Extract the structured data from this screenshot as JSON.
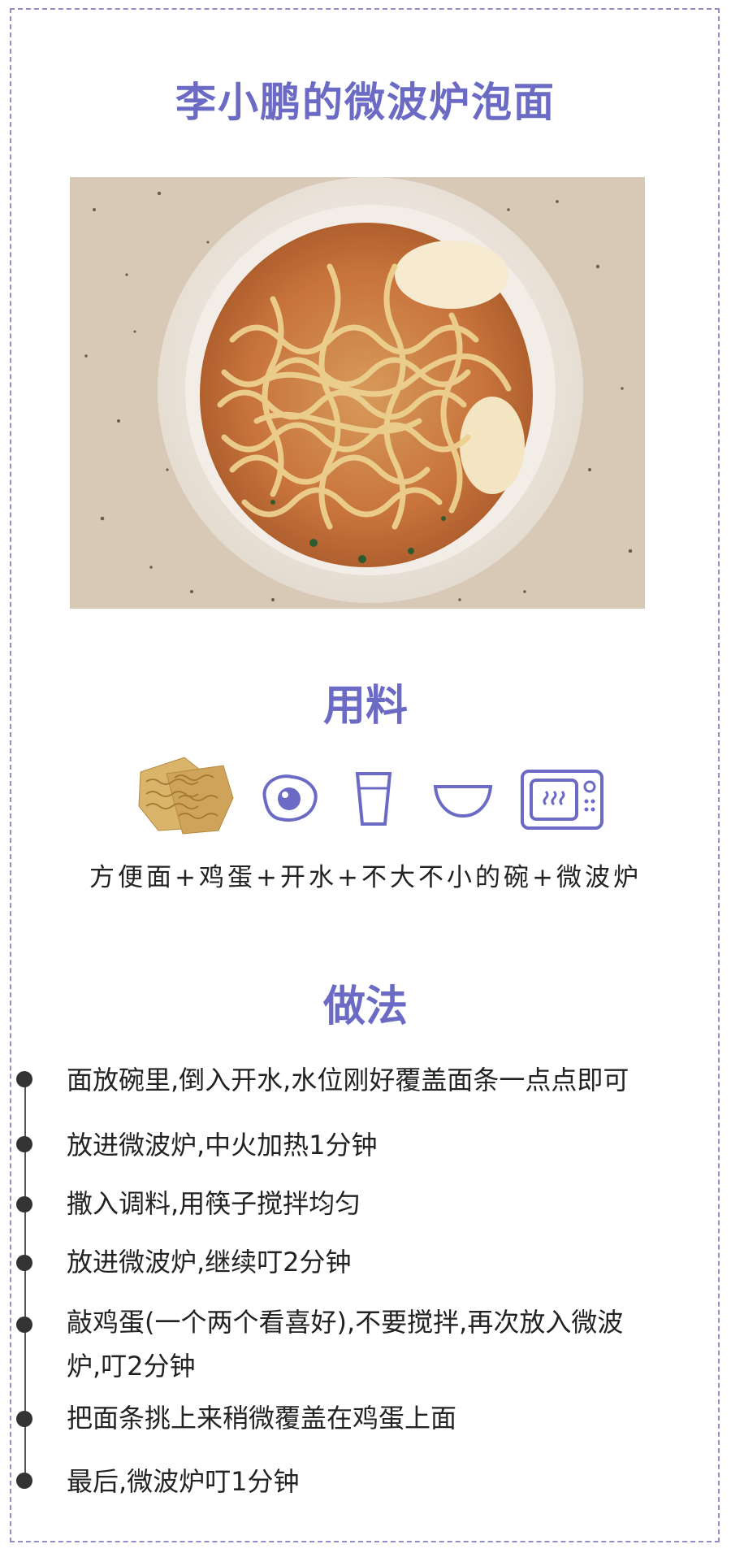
{
  "title": "李小鹏的微波炉泡面",
  "photo": {
    "alt_icon": "instant-noodle-bowl-photo",
    "colors": {
      "counter": "#d8c9b6",
      "bowl": "#efe9e2",
      "broth": "#c8743c",
      "noodle": "#e7c98a",
      "egg": "#f4e7c8"
    }
  },
  "ingredients_section": {
    "heading": "用料",
    "icons": [
      "instant-noodle-block-icon",
      "fried-egg-icon",
      "glass-of-water-icon",
      "bowl-icon",
      "microwave-icon"
    ],
    "line": "方便面+鸡蛋+开水+不大不小的碗+微波炉"
  },
  "method_section": {
    "heading": "做法",
    "steps": [
      "面放碗里,倒入开水,水位刚好覆盖面条一点点即可",
      "放进微波炉,中火加热1分钟",
      "撒入调料,用筷子搅拌均匀",
      "放进微波炉,继续叮2分钟",
      "敲鸡蛋(一个两个看喜好),不要搅拌,再次放入微波\n炉,叮2分钟",
      "把面条挑上来稍微覆盖在鸡蛋上面",
      "最后,微波炉叮1分钟"
    ]
  },
  "accent_color": "#6b6bc6"
}
